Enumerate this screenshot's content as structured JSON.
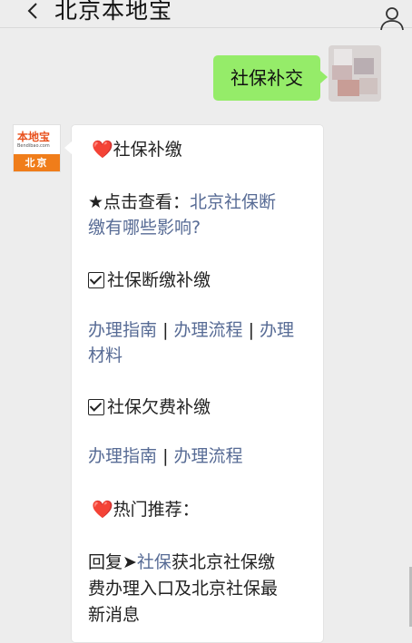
{
  "header": {
    "title": "北京本地宝"
  },
  "my_message": {
    "text": "社保补交"
  },
  "logo": {
    "text": "本地宝",
    "subtext": "Bendibao.com",
    "city": "北京"
  },
  "reply": {
    "section1_title": "社保补缴",
    "star_prefix": "★点击查看：",
    "star_link_line1": "北京社保断",
    "star_link_line2": "缴有哪些影响?",
    "section2_title": "社保断缴补缴",
    "link_guide": "办理指南",
    "sep": "|",
    "link_process": "办理流程",
    "link_materials_1": "办理",
    "link_materials_2": "材料",
    "section3_title": "社保欠费补缴",
    "section4_title": "热门推荐：",
    "reply_prefix": "回复➤",
    "reply_keyword": "社保",
    "reply_rest_1": "获北京社保缴",
    "reply_rest_2": "费办理入口及北京社保最",
    "reply_rest_3": "新消息"
  },
  "icons": {
    "back": "chevron-left-icon",
    "profile": "person-icon",
    "heart": "heart-icon",
    "checkbox": "checkbox-icon"
  },
  "colors": {
    "bubble_green": "#95ec69",
    "link": "#576b95",
    "heart": "#d8232a",
    "logo_orange": "#f07d1a"
  }
}
